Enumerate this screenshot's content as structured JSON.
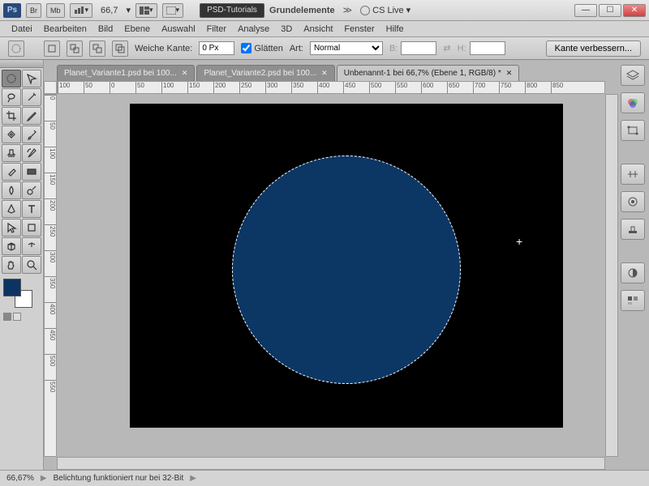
{
  "titlebar": {
    "ps": "Ps",
    "br": "Br",
    "mb": "Mb",
    "zoom": "66,7",
    "psd_tutorials": "PSD-Tutorials",
    "grundelemente": "Grundelemente",
    "cs_live": "CS Live"
  },
  "menu": [
    "Datei",
    "Bearbeiten",
    "Bild",
    "Ebene",
    "Auswahl",
    "Filter",
    "Analyse",
    "3D",
    "Ansicht",
    "Fenster",
    "Hilfe"
  ],
  "options": {
    "feather_label": "Weiche Kante:",
    "feather_value": "0 Px",
    "antialias_label": "Glätten",
    "style_label": "Art:",
    "style_value": "Normal",
    "width_label": "B:",
    "height_label": "H:",
    "refine_btn": "Kante verbessern..."
  },
  "tabs": [
    {
      "label": "Planet_Variante1.psd bei 100...",
      "active": false
    },
    {
      "label": "Planet_Variante2.psd bei 100...",
      "active": false
    },
    {
      "label": "Unbenannt-1 bei 66,7% (Ebene 1, RGB/8) *",
      "active": true
    }
  ],
  "rulers_h": [
    "100",
    "50",
    "0",
    "50",
    "100",
    "150",
    "200",
    "250",
    "300",
    "350",
    "400",
    "450",
    "500",
    "550",
    "600",
    "650",
    "700",
    "750",
    "800",
    "850"
  ],
  "rulers_v": [
    "0",
    "50",
    "100",
    "150",
    "200",
    "250",
    "300",
    "350",
    "400",
    "450",
    "500",
    "550"
  ],
  "colors": {
    "fg": "#0d3361",
    "bg": "#ffffff",
    "canvas_bg": "#000000",
    "ellipse_fill": "#0c3664"
  },
  "status": {
    "zoom": "66,67%",
    "message": "Belichtung funktioniert nur bei 32-Bit"
  }
}
